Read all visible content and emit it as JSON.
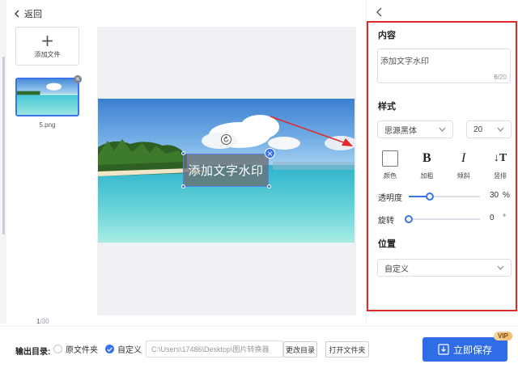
{
  "nav": {
    "back_label": "返回"
  },
  "files": {
    "add_label": "添加文件",
    "items": [
      {
        "name": "5.png"
      }
    ],
    "page_current": "1",
    "page_total": "/30"
  },
  "watermark_preview": {
    "text": "添加文字水印"
  },
  "panel": {
    "content_title": "内容",
    "content_value": "添加文字水印",
    "char_count": "6",
    "char_max": "/20",
    "style_title": "样式",
    "font_family": "思源黑体",
    "font_size": "20",
    "style_buttons": [
      {
        "label": "颜色",
        "icon": "color-swatch",
        "glyph": ""
      },
      {
        "label": "加粗",
        "icon": "bold-icon",
        "glyph": "B"
      },
      {
        "label": "倾斜",
        "icon": "italic-icon",
        "glyph": "I"
      },
      {
        "label": "竖排",
        "icon": "vertical-text-icon",
        "glyph": "↓T"
      }
    ],
    "opacity_label": "透明度",
    "opacity_value": "30",
    "opacity_unit": "%",
    "rotate_label": "旋转",
    "rotate_value": "0",
    "rotate_unit": "°",
    "position_title": "位置",
    "position_value": "自定义"
  },
  "footer": {
    "output_label": "输出目录:",
    "option_original": "原文件夹",
    "option_custom": "自定义",
    "path_value": "C:\\Users\\17486\\Desktop\\图片转换器",
    "change_dir_label": "更改目录",
    "open_folder_label": "打开文件夹",
    "save_label": "立即保存",
    "vip_badge": "VIP"
  },
  "colors": {
    "accent": "#2f6ce5",
    "highlight_frame": "#e0292a",
    "arrow": "#e0292a"
  }
}
